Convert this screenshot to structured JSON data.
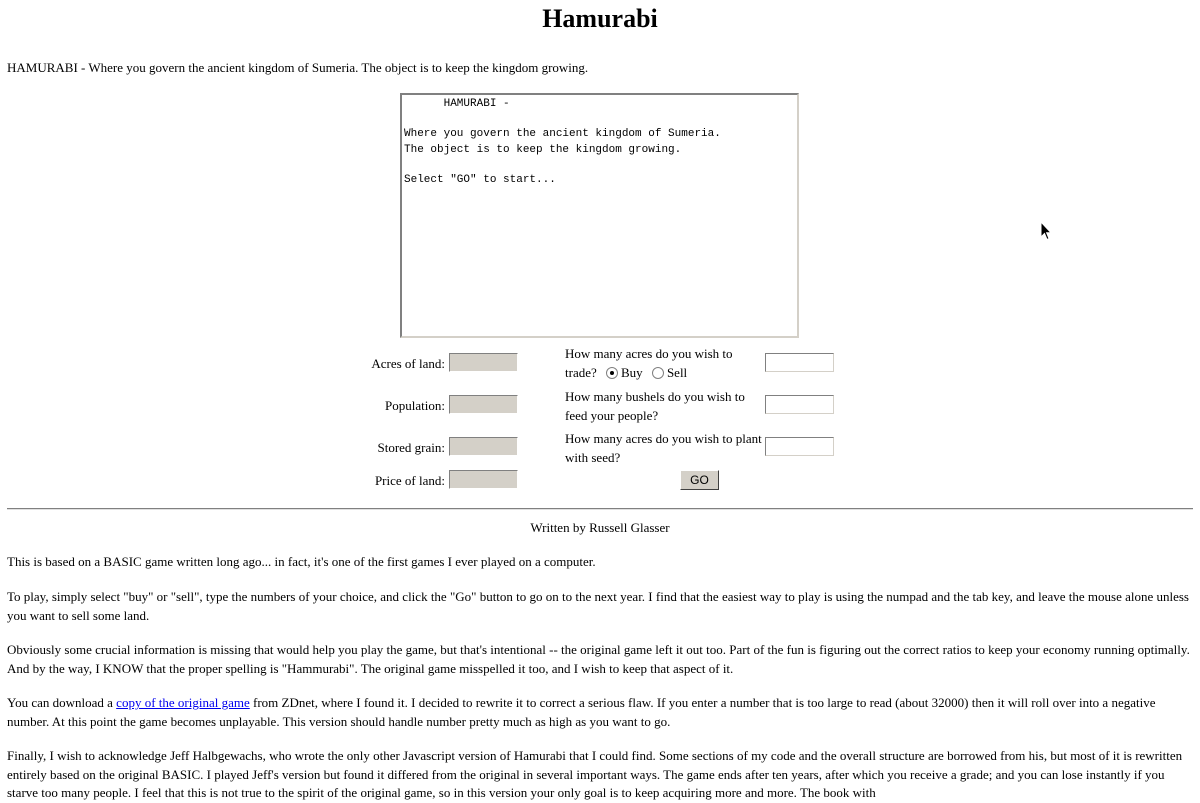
{
  "page": {
    "title": "Hamurabi",
    "intro": "HAMURABI - Where you govern the ancient kingdom of Sumeria. The object is to keep the kingdom growing."
  },
  "game": {
    "output_text": "      HAMURABI -\n\nWhere you govern the ancient kingdom of Sumeria.\nThe object is to keep the kingdom growing.\n\nSelect \"GO\" to start...",
    "labels": {
      "acres": "Acres of land:",
      "population": "Population:",
      "grain": "Stored grain:",
      "price": "Price of land:"
    },
    "questions": {
      "trade": "How many acres do you wish to trade?",
      "buy": "Buy",
      "sell": "Sell",
      "feed": "How many bushels do you wish to feed your people?",
      "plant": "How many acres do you wish to plant with seed?"
    },
    "trade_mode": "Buy",
    "go_label": "GO"
  },
  "footer": {
    "byline": "Written by Russell Glasser",
    "p1": "This is based on a BASIC game written long ago... in fact, it's one of the first games I ever played on a computer.",
    "p2": "To play, simply select \"buy\" or \"sell\", type the numbers of your choice, and click the \"Go\" button to go on to the next year. I find that the easiest way to play is using the numpad and the tab key, and leave the mouse alone unless you want to sell some land.",
    "p3": "Obviously some crucial information is missing that would help you play the game, but that's intentional -- the original game left it out too. Part of the fun is figuring out the correct ratios to keep your economy running optimally. And by the way, I KNOW that the proper spelling is \"Hammurabi\". The original game misspelled it too, and I wish to keep that aspect of it.",
    "p4_pre": "You can download a ",
    "p4_link": "copy of the original game",
    "p4_post": " from ZDnet, where I found it. I decided to rewrite it to correct a serious flaw. If you enter a number that is too large to read (about 32000) then it will roll over into a negative number. At this point the game becomes unplayable. This version should handle number pretty much as high as you want to go.",
    "p5": "Finally, I wish to acknowledge Jeff Halbgewachs, who wrote the only other Javascript version of Hamurabi that I could find. Some sections of my code and the overall structure are borrowed from his, but most of it is rewritten entirely based on the original BASIC. I played Jeff's version but found it differed from the original in several important ways. The game ends after ten years, after which you receive a grade; and you can lose instantly if you starve too many people. I feel that this is not true to the spirit of the original game, so in this version your only goal is to keep acquiring more and more. The book with"
  }
}
